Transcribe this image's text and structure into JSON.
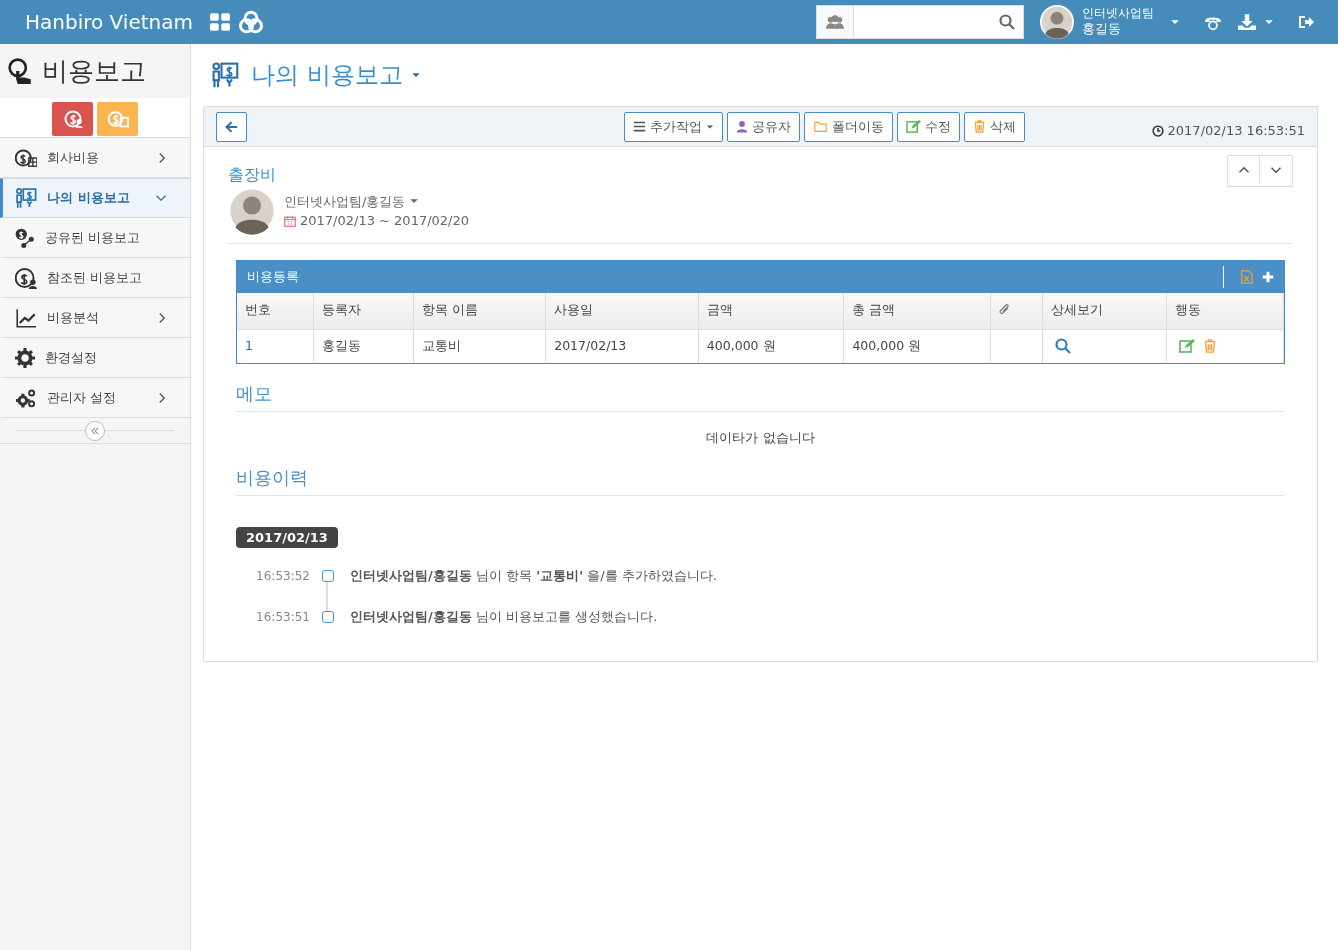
{
  "topbar": {
    "brand": "Hanbiro Vietnam",
    "user": {
      "team": "인터넷사업팀",
      "name": "홍길동"
    }
  },
  "sidebar": {
    "title": "비용보고",
    "items": [
      {
        "label": "회사비용",
        "kind": "group",
        "expanded": false,
        "selected": false
      },
      {
        "label": "나의 비용보고",
        "kind": "group",
        "expanded": true,
        "selected": true
      },
      {
        "label": "공유된 비용보고",
        "kind": "link",
        "selected": false
      },
      {
        "label": "참조된 비용보고",
        "kind": "link",
        "selected": false
      },
      {
        "label": "비용분석",
        "kind": "group",
        "expanded": false,
        "selected": false
      },
      {
        "label": "환경설정",
        "kind": "link",
        "selected": false
      },
      {
        "label": "관리자 설정",
        "kind": "group",
        "expanded": false,
        "selected": false
      }
    ]
  },
  "page_title": "나의 비용보고",
  "toolbar": {
    "buttons": [
      {
        "label": "추가작업",
        "kind": "menu"
      },
      {
        "label": "공유자",
        "kind": "share"
      },
      {
        "label": "폴더이동",
        "kind": "folder"
      },
      {
        "label": "수정",
        "kind": "edit"
      },
      {
        "label": "삭제",
        "kind": "delete"
      }
    ],
    "timestamp": "2017/02/13 16:53:51"
  },
  "report": {
    "title": "출장비",
    "author": "인터넷사업팀/홍길동",
    "period": "2017/02/13 ~ 2017/02/20"
  },
  "expense_table": {
    "title": "비용등록",
    "columns": [
      {
        "kind": "text",
        "label": "번호"
      },
      {
        "kind": "text",
        "label": "등록자"
      },
      {
        "kind": "text",
        "label": "항목 이름"
      },
      {
        "kind": "text",
        "label": "사용일"
      },
      {
        "kind": "text",
        "label": "금액"
      },
      {
        "kind": "text",
        "label": "총 금액"
      },
      {
        "kind": "attachment"
      },
      {
        "kind": "text",
        "label": "상세보기"
      },
      {
        "kind": "text",
        "label": "행동"
      }
    ],
    "rows": [
      {
        "cells": [
          "1",
          "홍길동",
          "교통비",
          "2017/02/13",
          "400,000 원",
          "400,000 원"
        ]
      }
    ]
  },
  "memo": {
    "title": "메모",
    "empty_text": "데이타가 없습니다"
  },
  "history": {
    "title": "비용이력",
    "groups": [
      {
        "date": "2017/02/13",
        "entries": [
          {
            "time": "16:53:52",
            "text": "**인터넷사업팀/홍길동** 님이 항목 **'교통비'** 을/를 추가하였습니다."
          },
          {
            "time": "16:53:51",
            "text": "**인터넷사업팀/홍길동** 님이 비용보고를 생성했습니다."
          }
        ]
      }
    ]
  }
}
